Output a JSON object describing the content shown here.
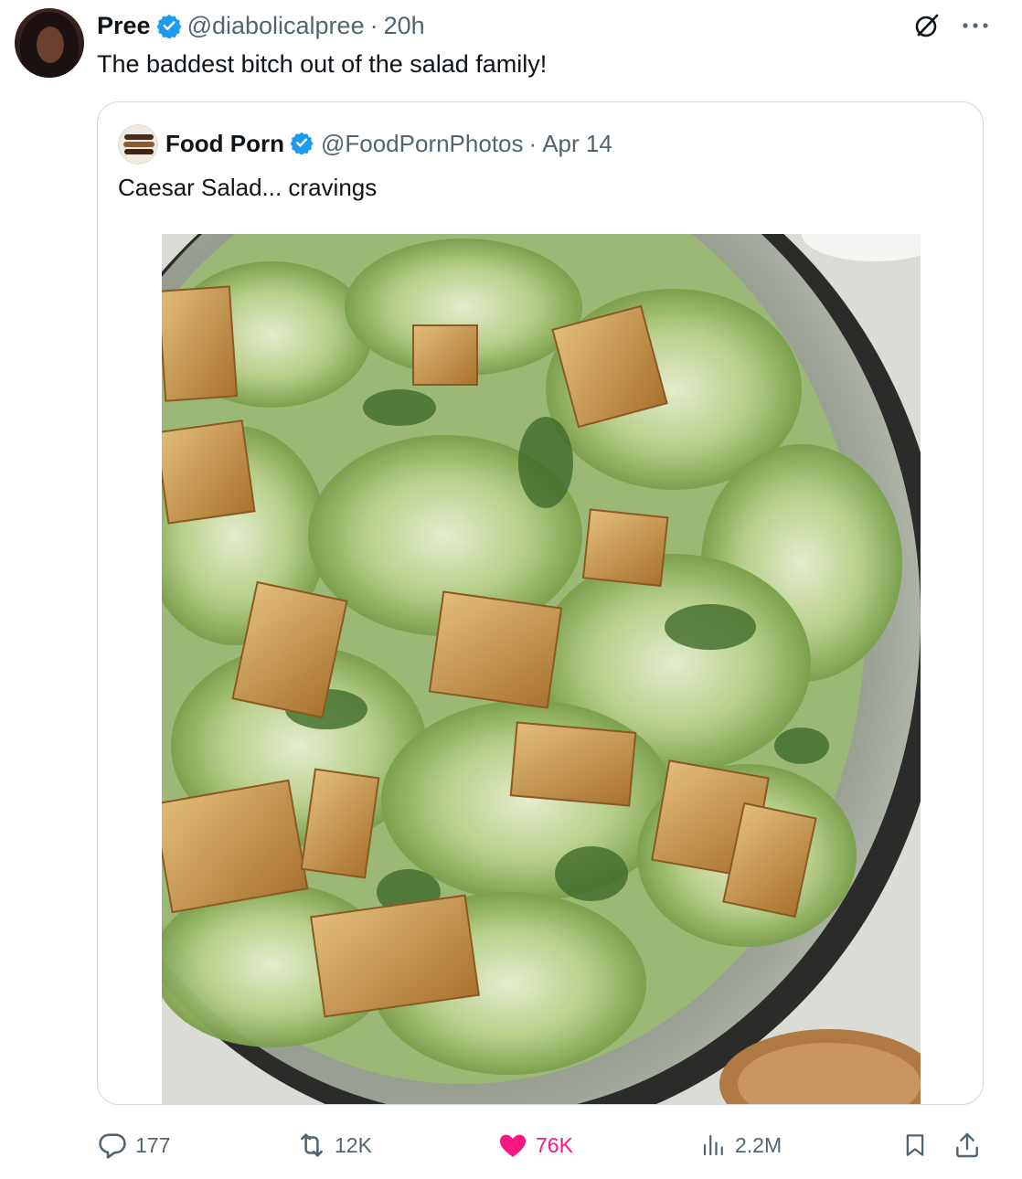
{
  "post": {
    "display_name": "Pree",
    "handle": "@diabolicalpree",
    "separator": "·",
    "time": "20h",
    "text": "The baddest bitch out of the salad family!",
    "verified": true
  },
  "quoted_post": {
    "display_name": "Food Porn",
    "handle": "@FoodPornPhotos",
    "separator": "·",
    "date": "Apr 14",
    "text": "Caesar Salad... cravings",
    "verified": true,
    "image": "caesar-salad-in-metal-bowl"
  },
  "actions": {
    "replies": "177",
    "reposts": "12K",
    "likes": "76K",
    "views": "2.2M",
    "liked": true
  },
  "colors": {
    "verified": "#1d9bf0",
    "like": "#f91880",
    "secondary_text": "#536471",
    "border": "#cfd9de"
  },
  "icons": [
    "grok-icon",
    "more-icon",
    "reply-icon",
    "repost-icon",
    "heart-icon",
    "views-icon",
    "bookmark-icon",
    "share-icon"
  ]
}
